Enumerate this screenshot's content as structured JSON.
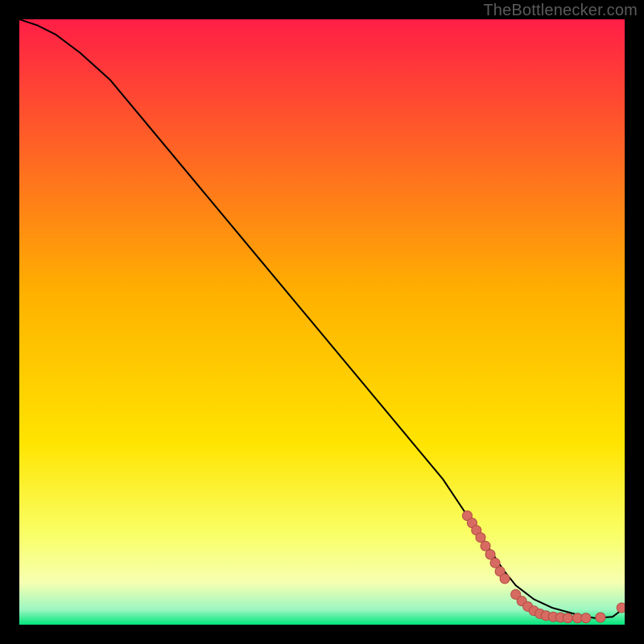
{
  "attribution": "TheBottlenecker.com",
  "colors": {
    "bg": "#000000",
    "gradient_top": "#ff1e46",
    "gradient_mid": "#ffd400",
    "gradient_yellow_light": "#f9ff66",
    "gradient_yellow_pale": "#f6ffb0",
    "gradient_green": "#00e57a",
    "curve": "#000000",
    "marker_fill": "#d76b61",
    "marker_stroke": "#b24c44",
    "watermark": "#5a5a5a"
  },
  "chart_data": {
    "type": "line",
    "title": "",
    "xlabel": "",
    "ylabel": "",
    "xlim": [
      0,
      100
    ],
    "ylim": [
      0,
      100
    ],
    "curve": {
      "x": [
        0,
        3,
        6,
        10,
        15,
        20,
        30,
        40,
        50,
        60,
        70,
        76,
        80,
        82,
        85,
        88,
        92,
        95,
        98,
        100
      ],
      "y": [
        100,
        99,
        97.5,
        94.5,
        90,
        84,
        72,
        60,
        48,
        36,
        24,
        15,
        9,
        6.5,
        4.2,
        2.8,
        1.7,
        1.1,
        1.3,
        2.8
      ]
    },
    "markers": [
      {
        "x": 74.0,
        "y": 18.0
      },
      {
        "x": 74.8,
        "y": 16.8
      },
      {
        "x": 75.5,
        "y": 15.6
      },
      {
        "x": 76.2,
        "y": 14.4
      },
      {
        "x": 77.0,
        "y": 13.0
      },
      {
        "x": 77.8,
        "y": 11.6
      },
      {
        "x": 78.6,
        "y": 10.2
      },
      {
        "x": 79.4,
        "y": 8.8
      },
      {
        "x": 80.2,
        "y": 7.6
      },
      {
        "x": 82.0,
        "y": 5.0
      },
      {
        "x": 83.0,
        "y": 3.9
      },
      {
        "x": 84.0,
        "y": 3.0
      },
      {
        "x": 85.0,
        "y": 2.3
      },
      {
        "x": 86.0,
        "y": 1.8
      },
      {
        "x": 87.0,
        "y": 1.5
      },
      {
        "x": 88.2,
        "y": 1.3
      },
      {
        "x": 89.4,
        "y": 1.2
      },
      {
        "x": 90.6,
        "y": 1.1
      },
      {
        "x": 92.2,
        "y": 1.1
      },
      {
        "x": 93.6,
        "y": 1.1
      },
      {
        "x": 96.0,
        "y": 1.2
      },
      {
        "x": 99.5,
        "y": 2.8
      }
    ]
  }
}
